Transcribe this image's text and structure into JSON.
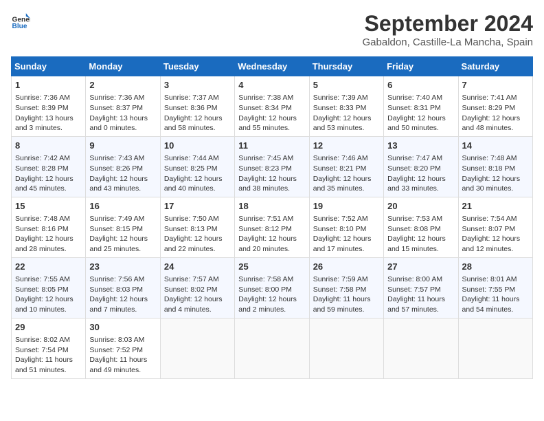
{
  "header": {
    "logo_line1": "General",
    "logo_line2": "Blue",
    "month": "September 2024",
    "location": "Gabaldon, Castille-La Mancha, Spain"
  },
  "weekdays": [
    "Sunday",
    "Monday",
    "Tuesday",
    "Wednesday",
    "Thursday",
    "Friday",
    "Saturday"
  ],
  "weeks": [
    [
      {
        "day": "1",
        "sunrise": "7:36 AM",
        "sunset": "8:39 PM",
        "daylight": "13 hours and 3 minutes."
      },
      {
        "day": "2",
        "sunrise": "7:36 AM",
        "sunset": "8:37 PM",
        "daylight": "13 hours and 0 minutes."
      },
      {
        "day": "3",
        "sunrise": "7:37 AM",
        "sunset": "8:36 PM",
        "daylight": "12 hours and 58 minutes."
      },
      {
        "day": "4",
        "sunrise": "7:38 AM",
        "sunset": "8:34 PM",
        "daylight": "12 hours and 55 minutes."
      },
      {
        "day": "5",
        "sunrise": "7:39 AM",
        "sunset": "8:33 PM",
        "daylight": "12 hours and 53 minutes."
      },
      {
        "day": "6",
        "sunrise": "7:40 AM",
        "sunset": "8:31 PM",
        "daylight": "12 hours and 50 minutes."
      },
      {
        "day": "7",
        "sunrise": "7:41 AM",
        "sunset": "8:29 PM",
        "daylight": "12 hours and 48 minutes."
      }
    ],
    [
      {
        "day": "8",
        "sunrise": "7:42 AM",
        "sunset": "8:28 PM",
        "daylight": "12 hours and 45 minutes."
      },
      {
        "day": "9",
        "sunrise": "7:43 AM",
        "sunset": "8:26 PM",
        "daylight": "12 hours and 43 minutes."
      },
      {
        "day": "10",
        "sunrise": "7:44 AM",
        "sunset": "8:25 PM",
        "daylight": "12 hours and 40 minutes."
      },
      {
        "day": "11",
        "sunrise": "7:45 AM",
        "sunset": "8:23 PM",
        "daylight": "12 hours and 38 minutes."
      },
      {
        "day": "12",
        "sunrise": "7:46 AM",
        "sunset": "8:21 PM",
        "daylight": "12 hours and 35 minutes."
      },
      {
        "day": "13",
        "sunrise": "7:47 AM",
        "sunset": "8:20 PM",
        "daylight": "12 hours and 33 minutes."
      },
      {
        "day": "14",
        "sunrise": "7:48 AM",
        "sunset": "8:18 PM",
        "daylight": "12 hours and 30 minutes."
      }
    ],
    [
      {
        "day": "15",
        "sunrise": "7:48 AM",
        "sunset": "8:16 PM",
        "daylight": "12 hours and 28 minutes."
      },
      {
        "day": "16",
        "sunrise": "7:49 AM",
        "sunset": "8:15 PM",
        "daylight": "12 hours and 25 minutes."
      },
      {
        "day": "17",
        "sunrise": "7:50 AM",
        "sunset": "8:13 PM",
        "daylight": "12 hours and 22 minutes."
      },
      {
        "day": "18",
        "sunrise": "7:51 AM",
        "sunset": "8:12 PM",
        "daylight": "12 hours and 20 minutes."
      },
      {
        "day": "19",
        "sunrise": "7:52 AM",
        "sunset": "8:10 PM",
        "daylight": "12 hours and 17 minutes."
      },
      {
        "day": "20",
        "sunrise": "7:53 AM",
        "sunset": "8:08 PM",
        "daylight": "12 hours and 15 minutes."
      },
      {
        "day": "21",
        "sunrise": "7:54 AM",
        "sunset": "8:07 PM",
        "daylight": "12 hours and 12 minutes."
      }
    ],
    [
      {
        "day": "22",
        "sunrise": "7:55 AM",
        "sunset": "8:05 PM",
        "daylight": "12 hours and 10 minutes."
      },
      {
        "day": "23",
        "sunrise": "7:56 AM",
        "sunset": "8:03 PM",
        "daylight": "12 hours and 7 minutes."
      },
      {
        "day": "24",
        "sunrise": "7:57 AM",
        "sunset": "8:02 PM",
        "daylight": "12 hours and 4 minutes."
      },
      {
        "day": "25",
        "sunrise": "7:58 AM",
        "sunset": "8:00 PM",
        "daylight": "12 hours and 2 minutes."
      },
      {
        "day": "26",
        "sunrise": "7:59 AM",
        "sunset": "7:58 PM",
        "daylight": "11 hours and 59 minutes."
      },
      {
        "day": "27",
        "sunrise": "8:00 AM",
        "sunset": "7:57 PM",
        "daylight": "11 hours and 57 minutes."
      },
      {
        "day": "28",
        "sunrise": "8:01 AM",
        "sunset": "7:55 PM",
        "daylight": "11 hours and 54 minutes."
      }
    ],
    [
      {
        "day": "29",
        "sunrise": "8:02 AM",
        "sunset": "7:54 PM",
        "daylight": "11 hours and 51 minutes."
      },
      {
        "day": "30",
        "sunrise": "8:03 AM",
        "sunset": "7:52 PM",
        "daylight": "11 hours and 49 minutes."
      },
      null,
      null,
      null,
      null,
      null
    ]
  ]
}
